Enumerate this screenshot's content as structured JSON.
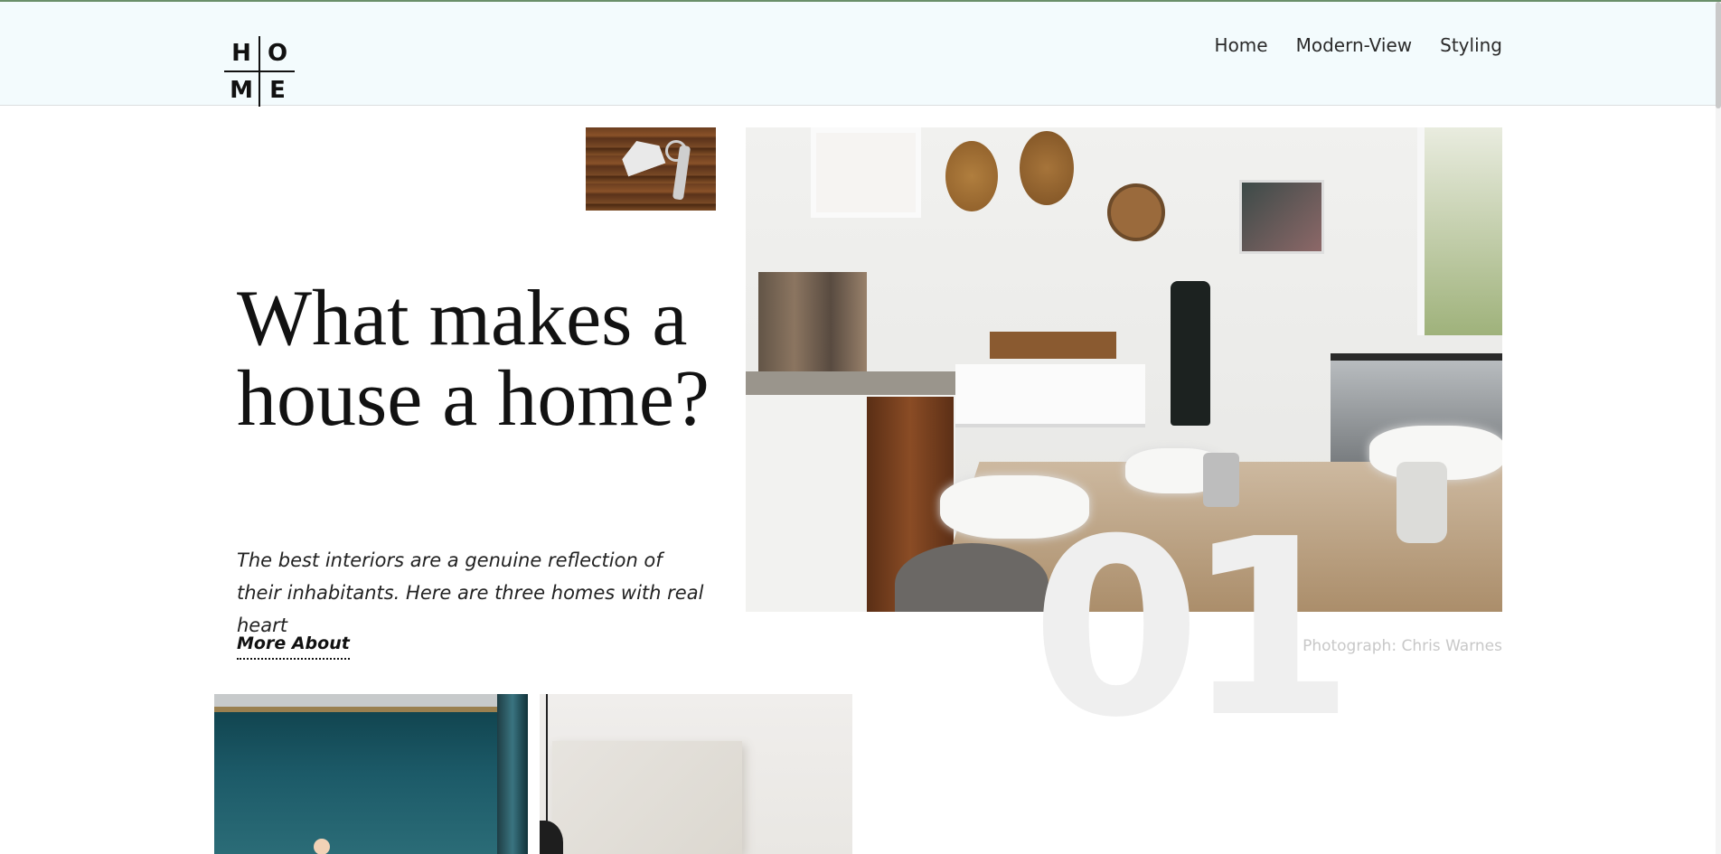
{
  "header": {
    "logo": {
      "letters": [
        "H",
        "O",
        "M",
        "E"
      ]
    },
    "nav": [
      {
        "label": "Home"
      },
      {
        "label": "Modern-View"
      },
      {
        "label": "Styling"
      }
    ]
  },
  "hero": {
    "headline": "What makes a house a home?",
    "subtitle": "The best interiors are a genuine reflection of their inhabitants. Here are three homes with real heart",
    "cta_label": "More About",
    "number": "01",
    "photo_credit": "Photograph: Chris Warnes"
  },
  "colors": {
    "header_bg": "#f3fbfd",
    "text": "#121212",
    "number": "#efefef",
    "credit": "#c8c8c8"
  }
}
